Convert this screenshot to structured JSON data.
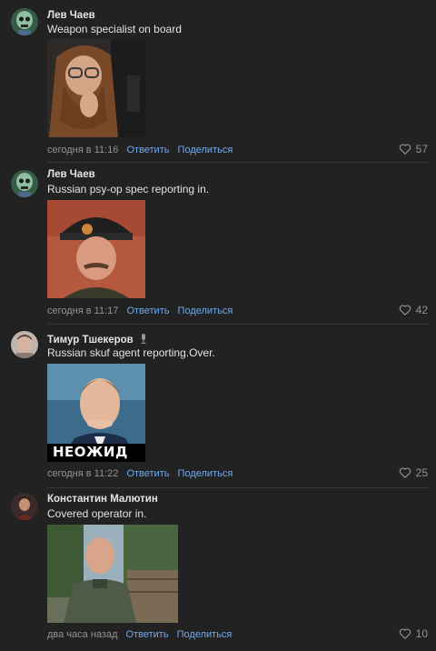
{
  "comments": [
    {
      "author": "Лев Чаев",
      "text": "Weapon specialist on board",
      "time": "сегодня в 11:16",
      "reply": "Ответить",
      "share": "Поделиться",
      "likes": "57",
      "avatar_icon": "zombie-avatar-icon"
    },
    {
      "author": "Лев Чаев",
      "text": "Russian psy-op spec reporting in.",
      "time": "сегодня в 11:17",
      "reply": "Ответить",
      "share": "Поделиться",
      "likes": "42",
      "avatar_icon": "zombie-avatar-icon"
    },
    {
      "author": "Тимур Тшекеров",
      "text": "Russian skuf agent reporting.Over.",
      "time": "сегодня в 11:22",
      "reply": "Ответить",
      "share": "Поделиться",
      "likes": "25",
      "image_caption": "НЕОЖИД",
      "avatar_icon": "person-avatar-icon"
    },
    {
      "author": "Константин Малютин",
      "text": "Covered operator in.",
      "time": "два часа назад",
      "reply": "Ответить",
      "share": "Поделиться",
      "likes": "10",
      "avatar_icon": "person-avatar-icon"
    }
  ],
  "colors": {
    "background": "#222222",
    "link": "#71aaeb",
    "muted": "#939393",
    "text": "#e1e3e6"
  }
}
